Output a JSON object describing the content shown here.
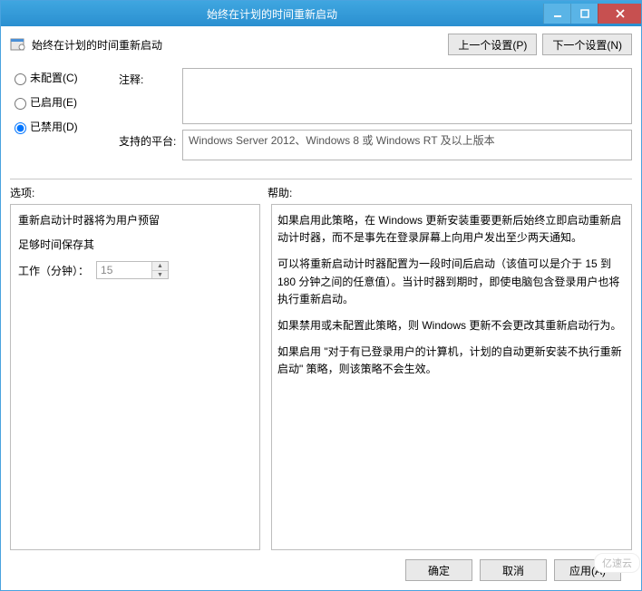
{
  "window": {
    "title": "始终在计划的时间重新启动",
    "minimize_icon": "minimize-icon",
    "maximize_icon": "maximize-icon",
    "close_icon": "close-icon"
  },
  "header": {
    "policy_name": "始终在计划的时间重新启动",
    "prev_setting": "上一个设置(P)",
    "next_setting": "下一个设置(N)"
  },
  "state": {
    "not_configured": "未配置(C)",
    "enabled": "已启用(E)",
    "disabled": "已禁用(D)",
    "selected": "disabled"
  },
  "form": {
    "comment_label": "注释:",
    "comment_value": "",
    "platform_label": "支持的平台:",
    "platform_value": "Windows Server 2012、Windows 8 或 Windows RT 及以上版本"
  },
  "sections": {
    "options_label": "选项:",
    "help_label": "帮助:"
  },
  "options": {
    "line1": "重新启动计时器将为用户预留",
    "line2": "足够时间保存其",
    "field_label": "工作（分钟）：",
    "field_value": "15"
  },
  "help_paragraphs": [
    "如果启用此策略，在 Windows 更新安装重要更新后始终立即启动重新启动计时器，而不是事先在登录屏幕上向用户发出至少两天通知。",
    "可以将重新启动计时器配置为一段时间后启动（该值可以是介于 15 到 180 分钟之间的任意值）。当计时器到期时，即使电脑包含登录用户也将执行重新启动。",
    "如果禁用或未配置此策略，则 Windows 更新不会更改其重新启动行为。",
    "如果启用 \"对于有已登录用户的计算机，计划的自动更新安装不执行重新启动\" 策略，则该策略不会生效。"
  ],
  "buttons": {
    "ok": "确定",
    "cancel": "取消",
    "apply": "应用(A)"
  },
  "watermark": "亿速云"
}
